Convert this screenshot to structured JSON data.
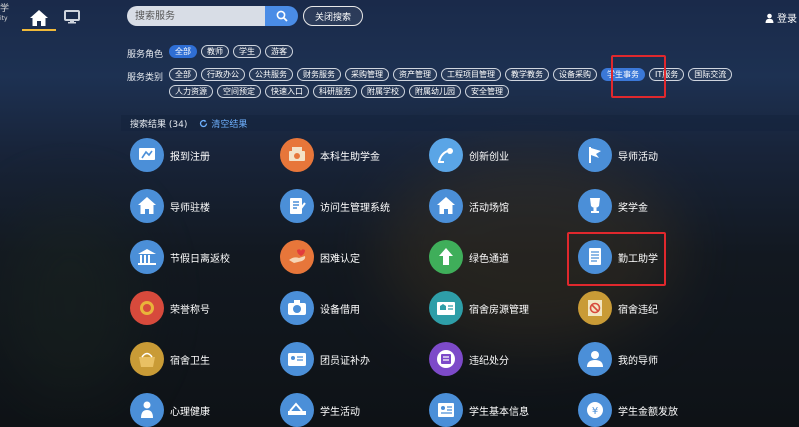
{
  "topbar": {
    "logo": "学",
    "logo_sub": "ity",
    "search_placeholder": "搜索服务",
    "close_search_label": "关闭搜索",
    "login_label": "登录"
  },
  "filters": {
    "role_label": "服务角色",
    "roles": [
      "全部",
      "教师",
      "学生",
      "游客"
    ],
    "category_label": "服务类别",
    "categories_row1": [
      "全部",
      "行政办公",
      "公共服务",
      "财务服务",
      "采购管理",
      "资产管理",
      "工程项目管理",
      "教学教务",
      "设备采购",
      "学生事务",
      "IT服务",
      "国际交流"
    ],
    "categories_row2": [
      "人力资源",
      "空间预定",
      "快速入口",
      "科研服务",
      "附属学校",
      "附属幼儿园",
      "安全管理"
    ]
  },
  "results": {
    "count_label": "搜索结果 (34)",
    "clear_label": "清空结果"
  },
  "services": [
    {
      "label": "报到注册",
      "icon": "register-icon",
      "color": "#4b8fd8"
    },
    {
      "label": "本科生助学金",
      "icon": "grant-icon",
      "color": "#e7763a"
    },
    {
      "label": "创新创业",
      "icon": "satellite-icon",
      "color": "#5aa5e6"
    },
    {
      "label": "导师活动",
      "icon": "flag-icon",
      "color": "#4b8fd8"
    },
    {
      "label": "导师驻楼",
      "icon": "home-icon",
      "color": "#4b8fd8"
    },
    {
      "label": "访问生管理系统",
      "icon": "edit-icon",
      "color": "#4b8fd8"
    },
    {
      "label": "活动场馆",
      "icon": "home-icon",
      "color": "#4b8fd8"
    },
    {
      "label": "奖学金",
      "icon": "trophy-icon",
      "color": "#4b8fd8"
    },
    {
      "label": "节假日离返校",
      "icon": "building-icon",
      "color": "#4b8fd8"
    },
    {
      "label": "困难认定",
      "icon": "hand-icon",
      "color": "#e7763a"
    },
    {
      "label": "绿色通道",
      "icon": "arrow-up-icon",
      "color": "#3fae5a"
    },
    {
      "label": "勤工助学",
      "icon": "document-icon",
      "color": "#4b8fd8"
    },
    {
      "label": "荣誉称号",
      "icon": "medal-icon",
      "color": "#d74a3c"
    },
    {
      "label": "设备借用",
      "icon": "camera-icon",
      "color": "#4b8fd8"
    },
    {
      "label": "宿舍房源管理",
      "icon": "house-list-icon",
      "color": "#2e9ea8"
    },
    {
      "label": "宿舍违纪",
      "icon": "no-sign-icon",
      "color": "#c99b36"
    },
    {
      "label": "宿舍卫生",
      "icon": "basket-icon",
      "color": "#c99b36"
    },
    {
      "label": "团员证补办",
      "icon": "id-card-icon",
      "color": "#4b8fd8"
    },
    {
      "label": "违纪处分",
      "icon": "calendar-icon",
      "color": "#7d4ac9"
    },
    {
      "label": "我的导师",
      "icon": "user-icon",
      "color": "#4b8fd8"
    },
    {
      "label": "心理健康",
      "icon": "person-icon",
      "color": "#4b8fd8"
    },
    {
      "label": "学生活动",
      "icon": "activity-icon",
      "color": "#4b8fd8"
    },
    {
      "label": "学生基本信息",
      "icon": "info-card-icon",
      "color": "#4b8fd8"
    },
    {
      "label": "学生金额发放",
      "icon": "money-icon",
      "color": "#4b8fd8"
    }
  ],
  "colors": {
    "accent": "#2f6ed4",
    "highlight_border": "#e0282d",
    "tab_underline": "#f0b93a"
  }
}
